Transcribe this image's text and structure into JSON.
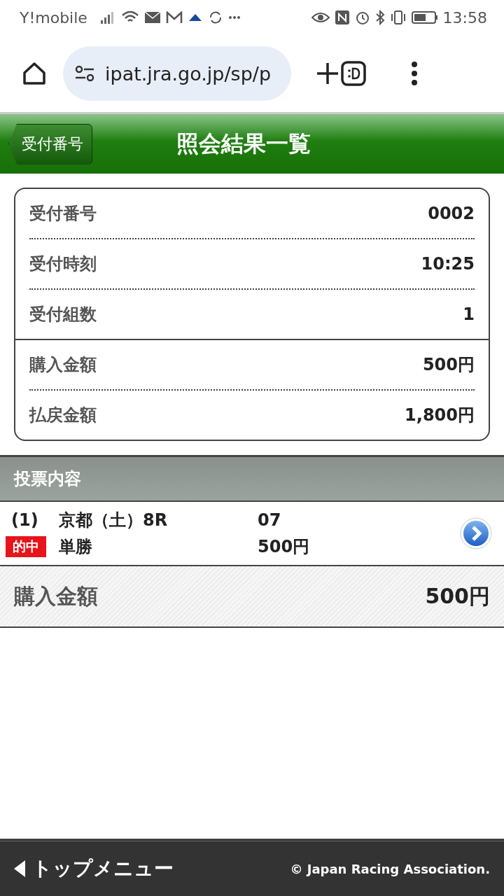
{
  "status_bar": {
    "carrier": "Y!mobile",
    "time": "13:58"
  },
  "browser": {
    "url": "ipat.jra.go.jp/sp/p"
  },
  "header": {
    "back_label": "受付番号",
    "title": "照会結果一覧"
  },
  "summary": {
    "groups": [
      [
        {
          "label": "受付番号",
          "value": "0002"
        },
        {
          "label": "受付時刻",
          "value": "10:25"
        },
        {
          "label": "受付組数",
          "value": "1"
        }
      ],
      [
        {
          "label": "購入金額",
          "value": "500円"
        },
        {
          "label": "払戻金額",
          "value": "1,800円"
        }
      ]
    ]
  },
  "section": {
    "title": "投票内容"
  },
  "bets": [
    {
      "index": "(1)",
      "race": "京都（土）8R",
      "numbers": "07",
      "badge": "的中",
      "bet_type": "単勝",
      "amount": "500円"
    }
  ],
  "total": {
    "label": "購入金額",
    "value": "500円"
  },
  "footer": {
    "menu": "トップメニュー",
    "copyright": "© Japan Racing Association."
  }
}
